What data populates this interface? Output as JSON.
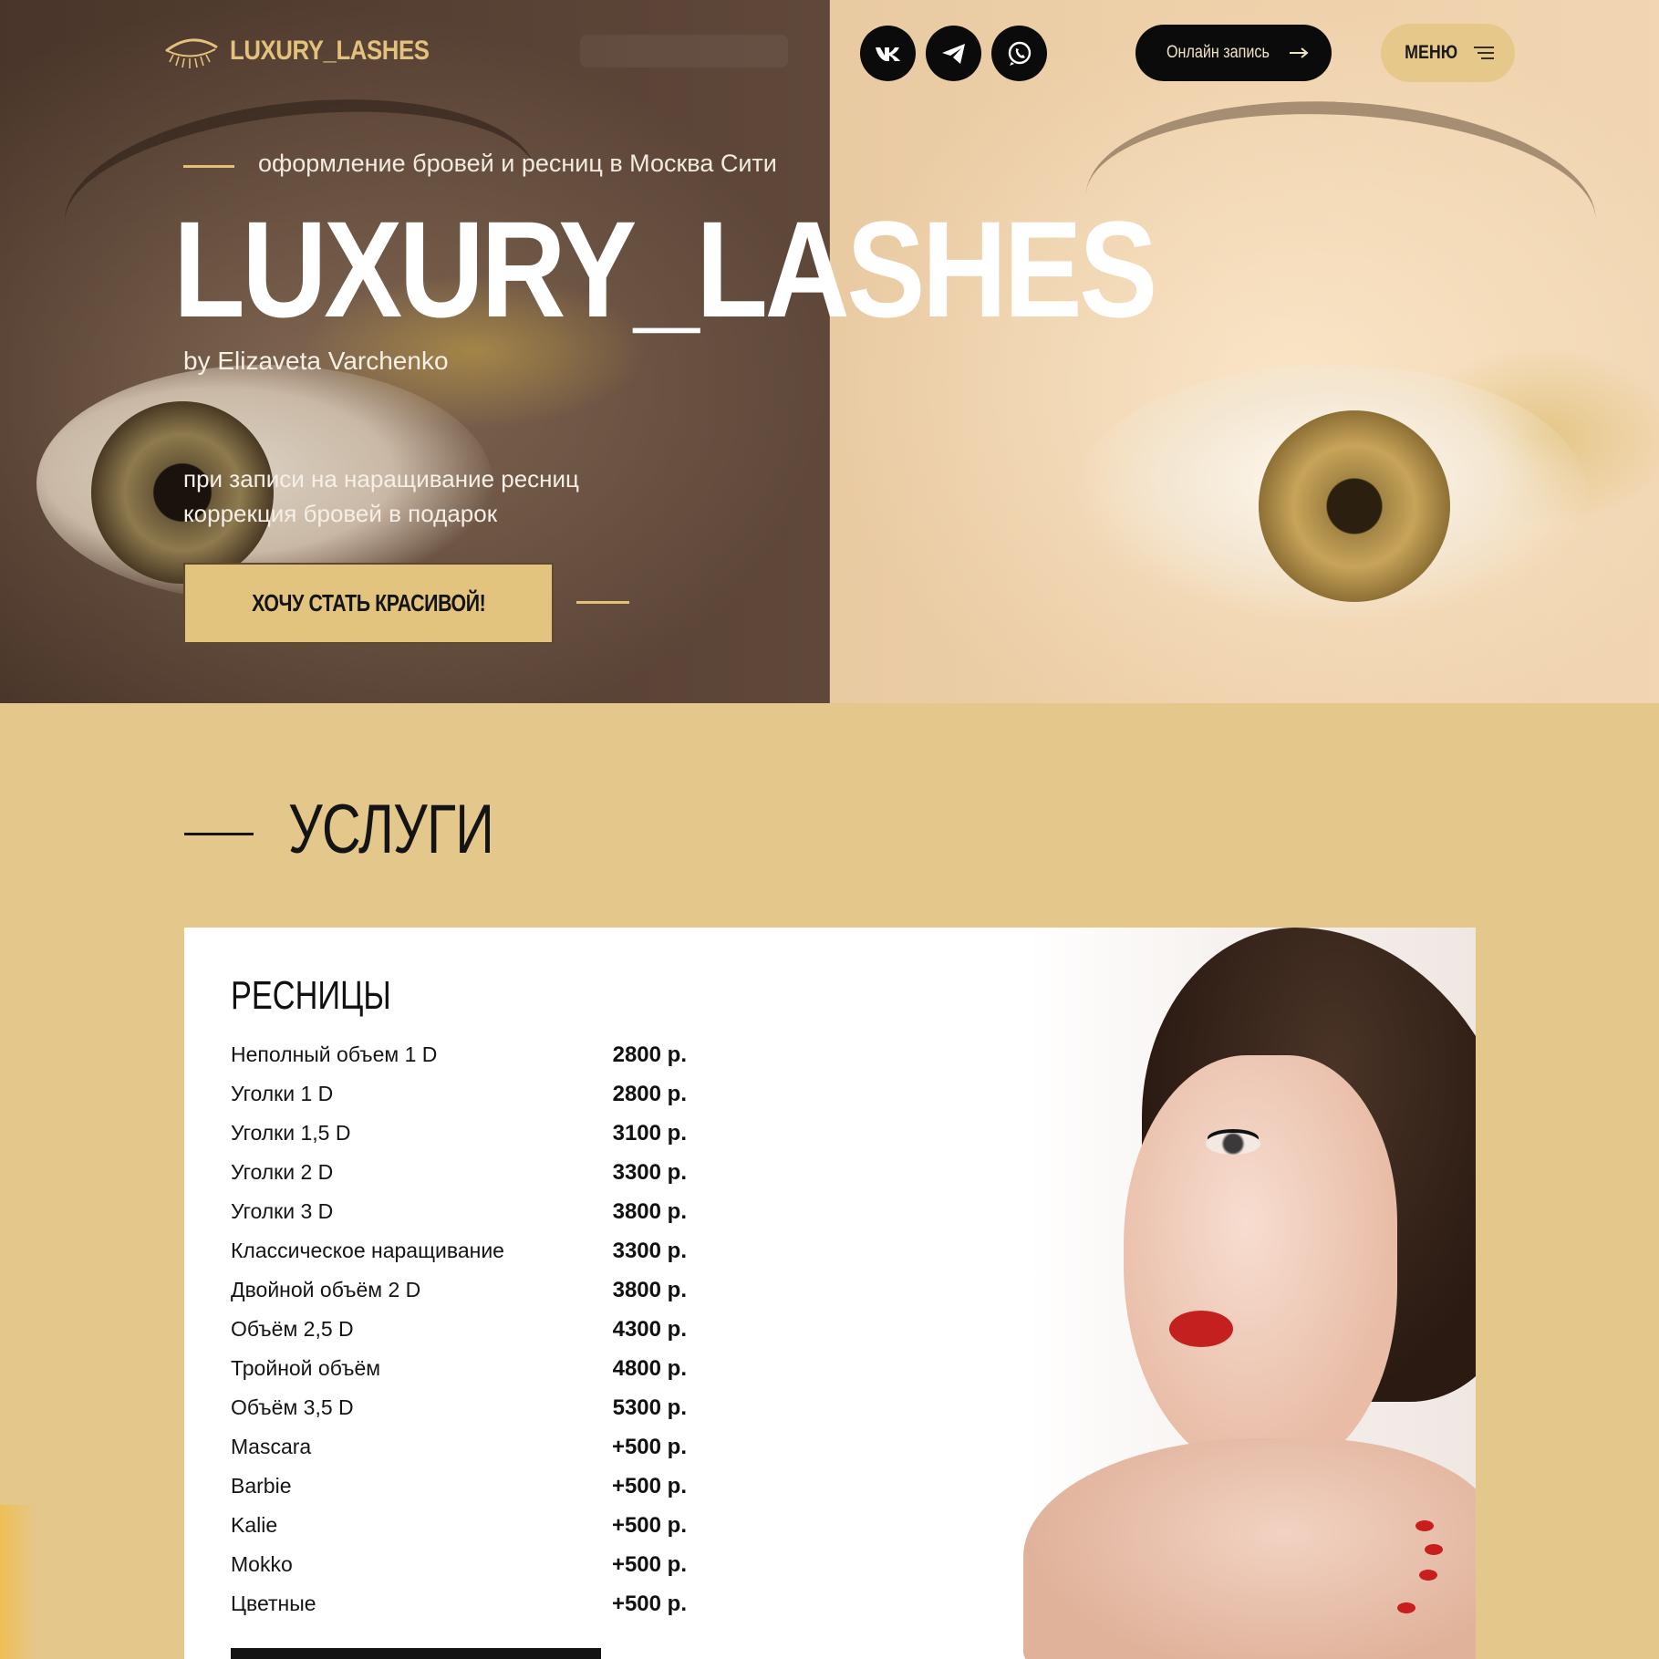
{
  "header": {
    "logo_text": "LUXURY_LASHES",
    "social": [
      "vk-icon",
      "telegram-icon",
      "whatsapp-icon"
    ],
    "online_booking_label": "Онлайн запись",
    "menu_label": "МЕНЮ"
  },
  "hero": {
    "subtitle": "оформление бровей и ресниц в Москва Сити",
    "title": "LUXURY_LASHES",
    "byline": "by Elizaveta Varchenko",
    "promo_line1": "при записи на наращивание ресниц",
    "promo_line2": "коррекция бровей в подарок",
    "cta_label": "ХОЧУ СТАТЬ КРАСИВОЙ!"
  },
  "services": {
    "title": "УСЛУГИ",
    "card": {
      "heading": "РЕСНИЦЫ",
      "items": [
        {
          "name": "Неполный объем 1 D",
          "price": "2800 р."
        },
        {
          "name": "Уголки 1 D",
          "price": "2800 р."
        },
        {
          "name": "Уголки 1,5 D",
          "price": "3100 р."
        },
        {
          "name": "Уголки 2 D",
          "price": "3300 р."
        },
        {
          "name": "Уголки 3 D",
          "price": "3800 р."
        },
        {
          "name": "Классическое наращивание",
          "price": "3300 р."
        },
        {
          "name": "Двойной объём 2 D",
          "price": "3800 р."
        },
        {
          "name": "Объём 2,5 D",
          "price": "4300 р."
        },
        {
          "name": "Тройной объём",
          "price": "4800 р."
        },
        {
          "name": "Объём 3,5 D",
          "price": "5300 р."
        },
        {
          "name": "Mascara",
          "price": "+500 р."
        },
        {
          "name": "Barbie",
          "price": "+500 р."
        },
        {
          "name": "Kalie",
          "price": "+500 р."
        },
        {
          "name": "Mokko",
          "price": "+500 р."
        },
        {
          "name": "Цветные",
          "price": "+500 р."
        }
      ]
    }
  },
  "colors": {
    "gold": "#e4c78a",
    "dark": "#0b0b0b",
    "white": "#ffffff"
  }
}
